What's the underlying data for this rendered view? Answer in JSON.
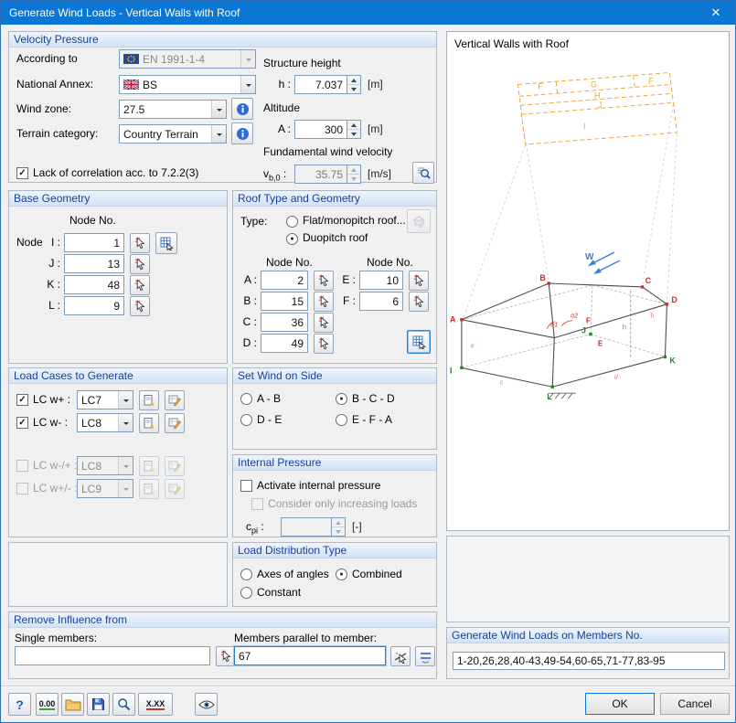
{
  "window": {
    "title": "Generate Wind Loads  -  Vertical Walls with Roof",
    "close_glyph": "✕"
  },
  "velocity": {
    "title": "Velocity Pressure",
    "according_label": "According to",
    "according_value": "EN 1991-1-4",
    "annex_label": "National Annex:",
    "annex_value": "BS",
    "wind_zone_label": "Wind zone:",
    "wind_zone_value": "27.5",
    "terrain_label": "Terrain category:",
    "terrain_value": "Country Terrain",
    "correlation_check": "✓",
    "correlation_label": "Lack of correlation acc. to 7.2.2(3)",
    "structure_height_label": "Structure height",
    "h_label": "h :",
    "h_value": "7.037",
    "h_unit": "[m]",
    "altitude_label": "Altitude",
    "a_label": "A :",
    "a_value": "300",
    "a_unit": "[m]",
    "fundamental_label": "Fundamental wind velocity",
    "vb0_base": "v",
    "vb0_sub": "b,0",
    "vb0_colon": " :",
    "vb0_value": "35.75",
    "vb0_unit": "[m/s]"
  },
  "base_geometry": {
    "title": "Base Geometry",
    "col_header": "Node No.",
    "node_label": "Node",
    "rows": [
      {
        "label": "I :",
        "value": "1"
      },
      {
        "label": "J :",
        "value": "13"
      },
      {
        "label": "K :",
        "value": "48"
      },
      {
        "label": "L :",
        "value": "9"
      }
    ]
  },
  "roof": {
    "title": "Roof Type and Geometry",
    "type_label": "Type:",
    "flat_label": "Flat/monopitch roof...",
    "flat_dot": "",
    "duopitch_label": "Duopitch roof",
    "duopitch_dot": "●",
    "col_header_left": "Node No.",
    "col_header_right": "Node No.",
    "left_rows": [
      {
        "label": "A :",
        "value": "2"
      },
      {
        "label": "B :",
        "value": "15"
      },
      {
        "label": "C :",
        "value": "36"
      },
      {
        "label": "D :",
        "value": "49"
      }
    ],
    "right_rows": [
      {
        "label": "E :",
        "value": "10"
      },
      {
        "label": "F :",
        "value": "6"
      }
    ]
  },
  "load_cases": {
    "title": "Load Cases to Generate",
    "rows": [
      {
        "check": "✓",
        "label": "LC w+ :",
        "value": "LC7"
      },
      {
        "check": "✓",
        "label": "LC w- :",
        "value": "LC8"
      },
      {
        "check": "",
        "label": "LC w-/+ :",
        "value": "LC8"
      },
      {
        "check": "",
        "label": "LC w+/- :",
        "value": "LC9"
      }
    ]
  },
  "wind_side": {
    "title": "Set Wind on Side",
    "options": [
      {
        "label": "A - B",
        "dot": ""
      },
      {
        "label": "B - C - D",
        "dot": "●"
      },
      {
        "label": "D - E",
        "dot": ""
      },
      {
        "label": "E - F - A",
        "dot": ""
      }
    ]
  },
  "internal_pressure": {
    "title": "Internal Pressure",
    "activate_check": "",
    "activate_label": "Activate internal pressure",
    "consider_check": "",
    "consider_label": "Consider only increasing loads",
    "cpi_base": "c",
    "cpi_sub": "pi",
    "cpi_colon": " :",
    "cpi_value": "",
    "cpi_unit": "[-]"
  },
  "distribution": {
    "title": "Load Distribution Type",
    "options": [
      {
        "label": "Axes of angles",
        "dot": ""
      },
      {
        "label": "Combined",
        "dot": "●"
      },
      {
        "label": "Constant",
        "dot": ""
      }
    ]
  },
  "remove_influence": {
    "title": "Remove Influence from",
    "single_label": "Single members:",
    "single_value": "",
    "parallel_label": "Members parallel to member:",
    "parallel_value": "67"
  },
  "preview": {
    "title": "Vertical Walls with Roof",
    "letters": {
      "A": "A",
      "B": "B",
      "C": "C",
      "D": "D",
      "E": "E",
      "F": "F",
      "I": "I",
      "J": "J",
      "K": "K",
      "L": "L",
      "W": "W",
      "zF": "F",
      "zG": "G",
      "zF2": "F",
      "zH": "H",
      "zJ": "J",
      "zI": "I",
      "alpha1": "α1",
      "alpha2": "α2",
      "b": "b",
      "c": "c",
      "d": "d",
      "e": "e",
      "h": "h"
    }
  },
  "generate": {
    "title": "Generate Wind Loads on Members No.",
    "value": "1-20,26,28,40-43,49-54,60-65,71-77,83-95"
  },
  "footer": {
    "help_glyph": "?",
    "units_label": "0.00",
    "xxx_label": "X.XX",
    "ok": "OK",
    "cancel": "Cancel"
  }
}
